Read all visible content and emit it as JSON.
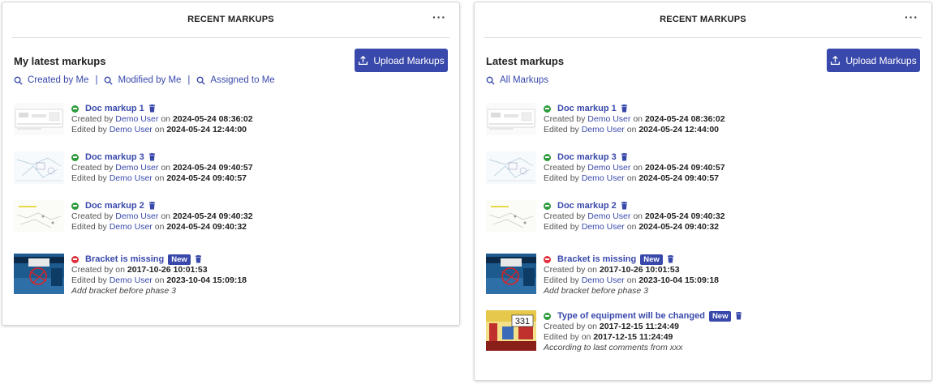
{
  "left_panel": {
    "header_title": "RECENT MARKUPS",
    "menu": "···",
    "section_title": "My latest markups",
    "upload_label": "Upload Markups",
    "filters": [
      "Created by Me",
      "Modified by Me",
      "Assigned to Me"
    ],
    "filter_separator": "|",
    "markups": [
      {
        "title": "Doc markup 1",
        "status": "ok",
        "created_prefix": "Created by",
        "created_user": "Demo User",
        "created_on": "on",
        "created_at": "2024-05-24 08:36:02",
        "edited_prefix": "Edited by",
        "edited_user": "Demo User",
        "edited_on": "on",
        "edited_at": "2024-05-24 12:44:00"
      },
      {
        "title": "Doc markup 3",
        "status": "ok",
        "created_prefix": "Created by",
        "created_user": "Demo User",
        "created_on": "on",
        "created_at": "2024-05-24 09:40:57",
        "edited_prefix": "Edited by",
        "edited_user": "Demo User",
        "edited_on": "on",
        "edited_at": "2024-05-24 09:40:57"
      },
      {
        "title": "Doc markup 2",
        "status": "ok",
        "created_prefix": "Created by",
        "created_user": "Demo User",
        "created_on": "on",
        "created_at": "2024-05-24 09:40:32",
        "edited_prefix": "Edited by",
        "edited_user": "Demo User",
        "edited_on": "on",
        "edited_at": "2024-05-24 09:40:32"
      },
      {
        "title": "Bracket is missing",
        "status": "bad",
        "badge": "New",
        "created_prefix": "Created by",
        "created_on": "on",
        "created_at": "2017-10-26 10:01:53",
        "edited_prefix": "Edited by",
        "edited_user": "Demo User",
        "edited_on": "on",
        "edited_at": "2023-10-04 15:09:18",
        "description": "Add bracket before phase 3"
      }
    ]
  },
  "right_panel": {
    "header_title": "RECENT MARKUPS",
    "menu": "···",
    "section_title": "Latest markups",
    "upload_label": "Upload Markups",
    "filters": [
      "All Markups"
    ],
    "markups": [
      {
        "title": "Doc markup 1",
        "status": "ok",
        "created_prefix": "Created by",
        "created_user": "Demo User",
        "created_on": "on",
        "created_at": "2024-05-24 08:36:02",
        "edited_prefix": "Edited by",
        "edited_user": "Demo User",
        "edited_on": "on",
        "edited_at": "2024-05-24 12:44:00"
      },
      {
        "title": "Doc markup 3",
        "status": "ok",
        "created_prefix": "Created by",
        "created_user": "Demo User",
        "created_on": "on",
        "created_at": "2024-05-24 09:40:57",
        "edited_prefix": "Edited by",
        "edited_user": "Demo User",
        "edited_on": "on",
        "edited_at": "2024-05-24 09:40:57"
      },
      {
        "title": "Doc markup 2",
        "status": "ok",
        "created_prefix": "Created by",
        "created_user": "Demo User",
        "created_on": "on",
        "created_at": "2024-05-24 09:40:32",
        "edited_prefix": "Edited by",
        "edited_user": "Demo User",
        "edited_on": "on",
        "edited_at": "2024-05-24 09:40:32"
      },
      {
        "title": "Bracket is missing",
        "status": "bad",
        "badge": "New",
        "created_prefix": "Created by",
        "created_on": "on",
        "created_at": "2017-10-26 10:01:53",
        "edited_prefix": "Edited by",
        "edited_user": "Demo User",
        "edited_on": "on",
        "edited_at": "2023-10-04 15:09:18",
        "description": "Add bracket before phase 3"
      },
      {
        "title": "Type of equipment will be changed",
        "status": "ok",
        "badge": "New",
        "created_prefix": "Created by",
        "created_on": "on",
        "created_at": "2017-12-15 11:24:49",
        "edited_prefix": "Edited by",
        "edited_on": "on",
        "edited_at": "2017-12-15 11:24:49",
        "description": "According to last comments from xxx",
        "thumb_label": "331"
      }
    ]
  },
  "colors": {
    "accent": "#3949ab",
    "status_ok": "#2e9c3c",
    "status_bad": "#e0303b"
  },
  "icons": {
    "upload": "upload-icon",
    "search": "search-icon",
    "trash": "trash-icon",
    "menu": "more-horizontal-icon"
  }
}
